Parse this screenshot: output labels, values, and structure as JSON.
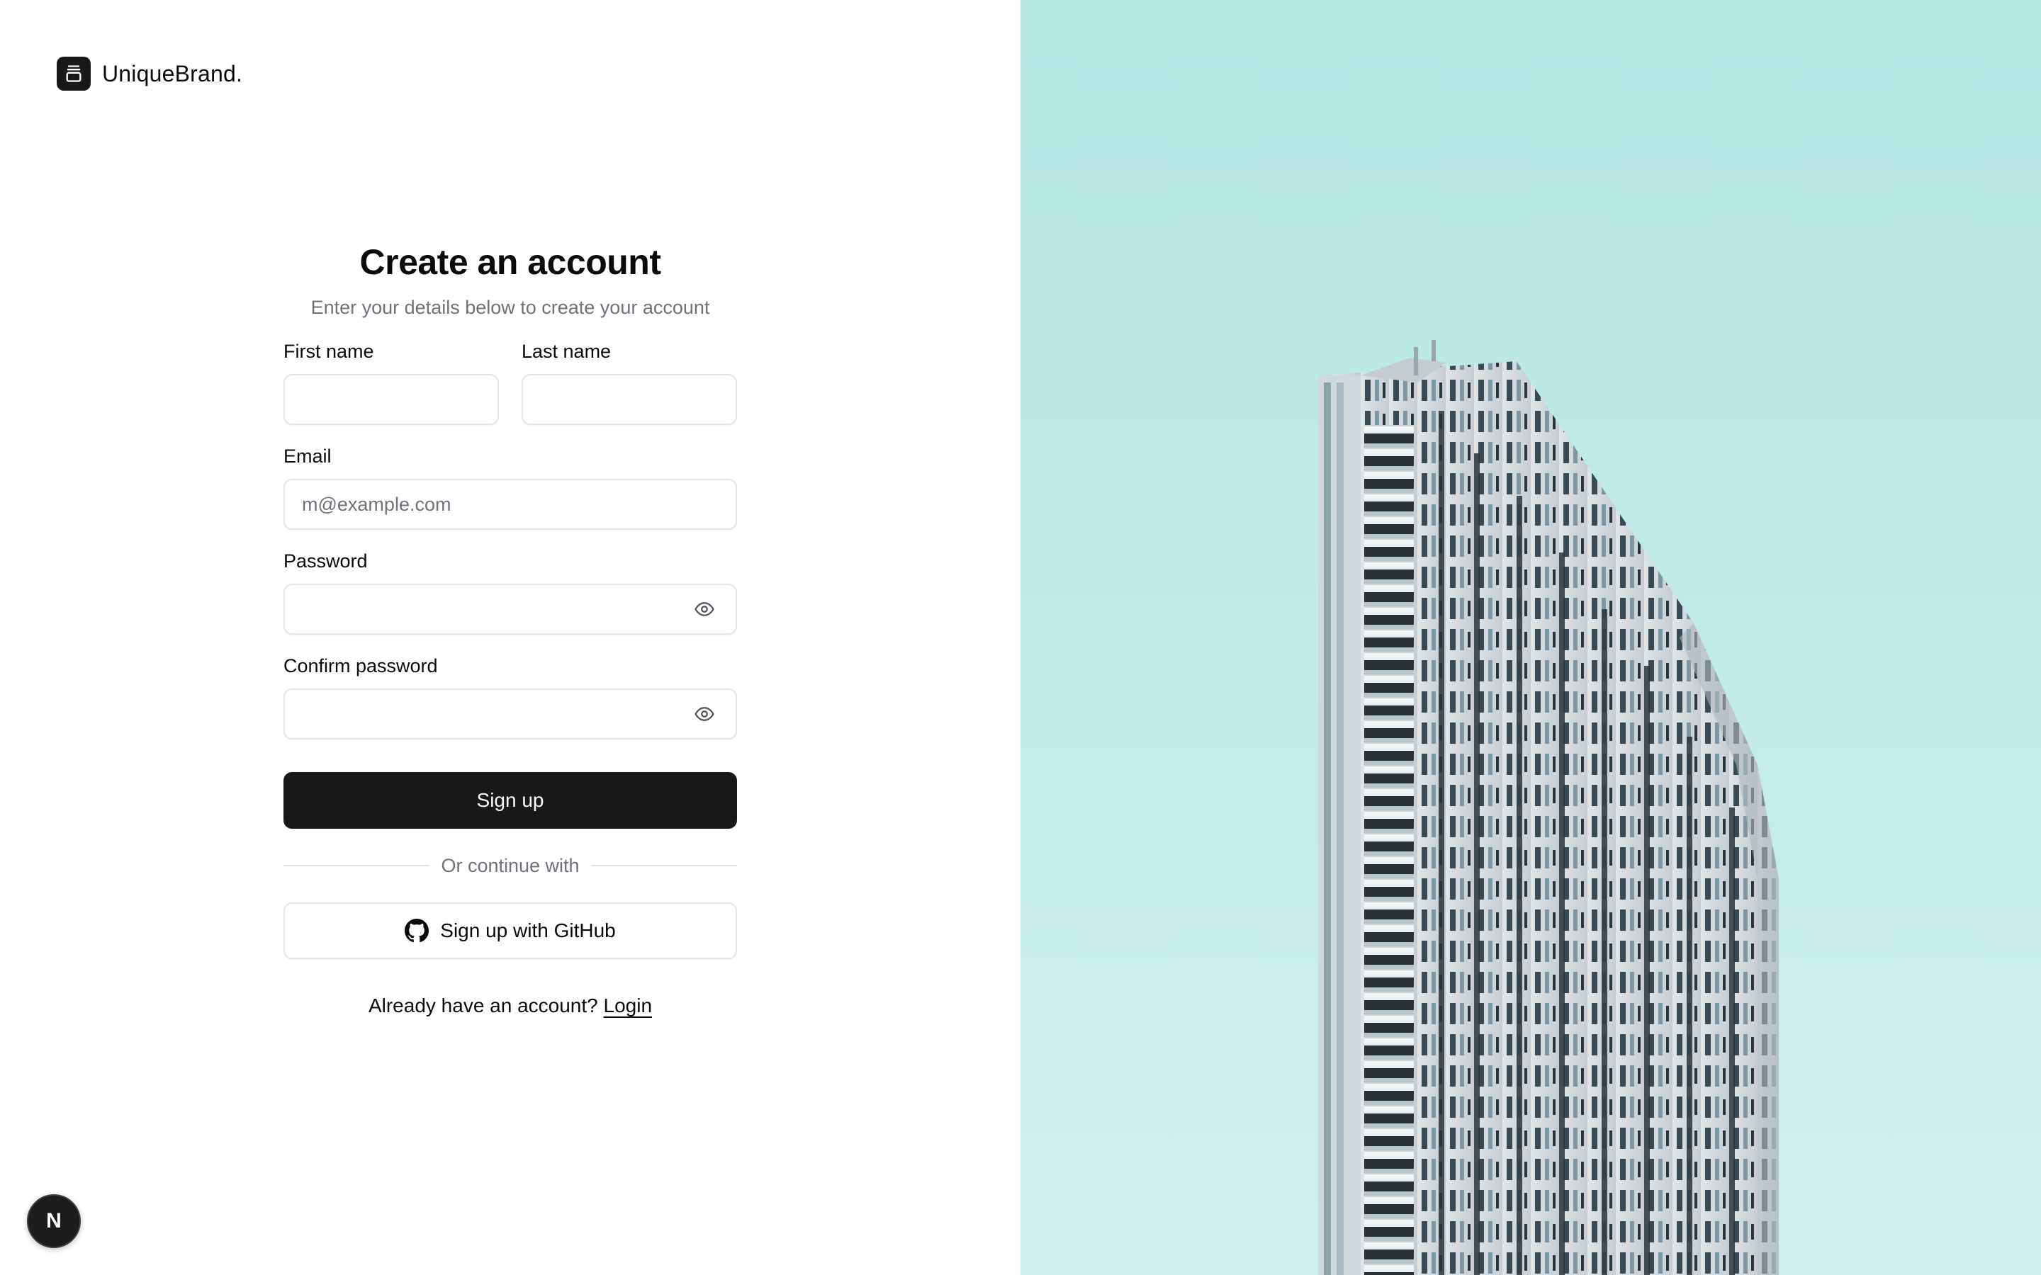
{
  "brand": {
    "name": "UniqueBrand.",
    "logo_icon": "box-archive-icon"
  },
  "form": {
    "title": "Create an account",
    "subtitle": "Enter your details below to create your account",
    "first_name": {
      "label": "First name",
      "value": "",
      "placeholder": ""
    },
    "last_name": {
      "label": "Last name",
      "value": "",
      "placeholder": ""
    },
    "email": {
      "label": "Email",
      "value": "",
      "placeholder": "m@example.com"
    },
    "password": {
      "label": "Password",
      "value": "",
      "placeholder": "",
      "toggle_icon": "eye-icon"
    },
    "confirm_password": {
      "label": "Confirm password",
      "value": "",
      "placeholder": "",
      "toggle_icon": "eye-icon"
    },
    "submit_label": "Sign up",
    "divider_text": "Or continue with",
    "github_label": "Sign up with GitHub",
    "github_icon": "github-icon",
    "login_prompt": "Already have an account?",
    "login_link": "Login"
  },
  "dev_badge": {
    "letter": "N",
    "icon": "nextjs-icon"
  },
  "hero_image": {
    "subject": "building-image"
  },
  "colors": {
    "primary": "#18181b",
    "muted_text": "#71717a",
    "border": "#e4e4e7",
    "sky": "#b4e6e2"
  }
}
